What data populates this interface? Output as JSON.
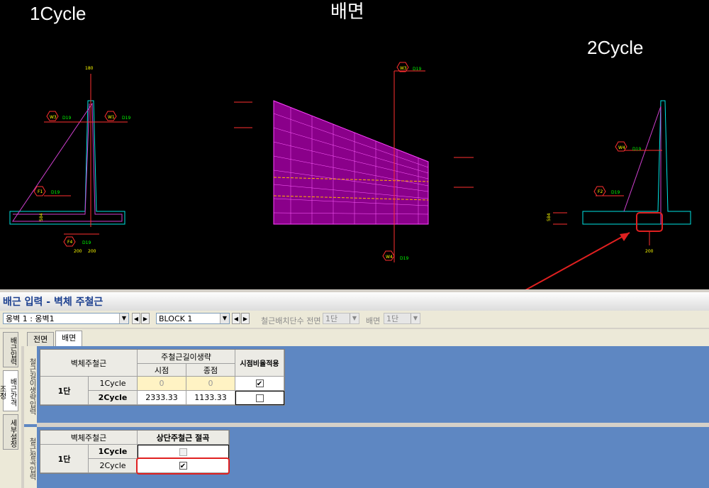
{
  "cad": {
    "label_1cycle": "1Cycle",
    "label_back": "배면",
    "label_2cycle": "2Cycle",
    "dim_top": "180",
    "dim_bottom_a": "200",
    "dim_bottom_b": "200",
    "dim_bottom_c": "200",
    "dim_side_a": "584",
    "dim_side_b": "584",
    "marks": {
      "w1": "W1",
      "w3": "W3",
      "w4": "W4",
      "f1": "F1",
      "f2": "F2",
      "f4": "F4",
      "d19": "D19"
    }
  },
  "panel": {
    "title": "배근 입력 - 벽체 주철근",
    "toolbar": {
      "wall_select": "옹벽 1 : 옹벽1",
      "block_select": "BLOCK  1",
      "rebar_count_label": "철근배치단수 전면",
      "front_value": "1단",
      "back_label": "배면",
      "back_value": "1단"
    },
    "vtabs": [
      "배근입력",
      "배근간격 조정",
      "세부설정"
    ],
    "htabs": [
      "전면",
      "배면"
    ],
    "group1_label": "철근길이생략입력",
    "group2_label": "철근절곡입력",
    "table1": {
      "col_main": "벽체주철근",
      "col_group": "주철근길이생략",
      "col_start": "시점",
      "col_end": "종점",
      "col_apply": "시점비율적용",
      "stage": "1단",
      "rows": [
        {
          "cycle": "1Cycle",
          "start": "0",
          "end": "0",
          "checked": "✔"
        },
        {
          "cycle": "2Cycle",
          "start": "2333.33",
          "end": "1133.33",
          "checked": ""
        }
      ]
    },
    "table2": {
      "col_main": "벽체주철근",
      "col_bend": "상단주철근 절곡",
      "stage": "1단",
      "rows": [
        {
          "cycle": "1Cycle",
          "checked": ""
        },
        {
          "cycle": "2Cycle",
          "checked": "✔"
        }
      ]
    },
    "colors": {
      "accent": "#5e87c2",
      "highlight": "#e02020"
    }
  }
}
